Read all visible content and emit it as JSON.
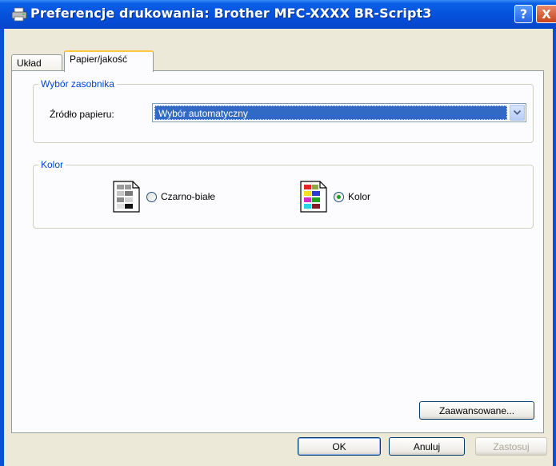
{
  "window": {
    "title": "Preferencje drukowania: Brother MFC-XXXX BR-Script3",
    "help_symbol": "?",
    "close_symbol": "X"
  },
  "tabs": [
    {
      "label": "Układ",
      "active": false
    },
    {
      "label": "Papier/jakość",
      "active": true
    }
  ],
  "tray_group": {
    "legend": "Wybór zasobnika",
    "source_label": "Źródło papieru:",
    "source_value": "Wybór automatyczny"
  },
  "color_group": {
    "legend": "Kolor",
    "option_bw": {
      "label": "Czarno-białe",
      "selected": false
    },
    "option_color": {
      "label": "Kolor",
      "selected": true
    }
  },
  "buttons": {
    "advanced": "Zaawansowane...",
    "ok": "OK",
    "cancel": "Anuluj",
    "apply": "Zastosuj"
  },
  "colors": {
    "titlebar": "#0550dc",
    "legend_text": "#0046d5",
    "selection": "#316ac5",
    "tab_highlight": "#ffc73c"
  }
}
